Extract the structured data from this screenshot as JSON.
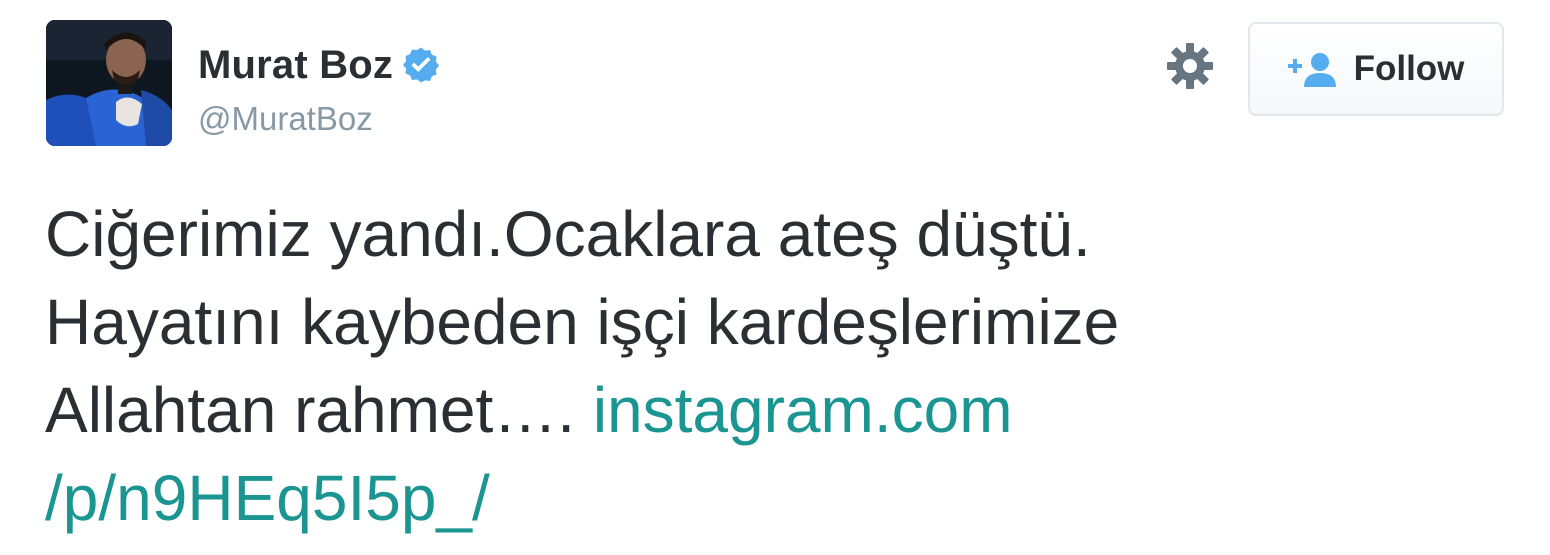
{
  "user": {
    "display_name": "Murat Boz",
    "handle": "@MuratBoz",
    "verified": true,
    "verified_color": "#55acee"
  },
  "actions": {
    "settings_icon": "gear-icon",
    "follow_label": "Follow",
    "follow_icon": "add-user-icon",
    "follow_icon_color": "#55acee"
  },
  "tweet": {
    "lines": [
      "Ciğerimiz yandı.Ocaklara ateş düştü.",
      "Hayatını kaybeden işçi kardeşlerimize",
      "Allahtan rahmet…. "
    ],
    "link_part1": "instagram.com",
    "link_part2": "/p/n9HEq5I5p_/",
    "link_color": "#1b9591"
  },
  "colors": {
    "text": "#292f33",
    "muted": "#8899a6",
    "border": "#e1e8ed"
  }
}
